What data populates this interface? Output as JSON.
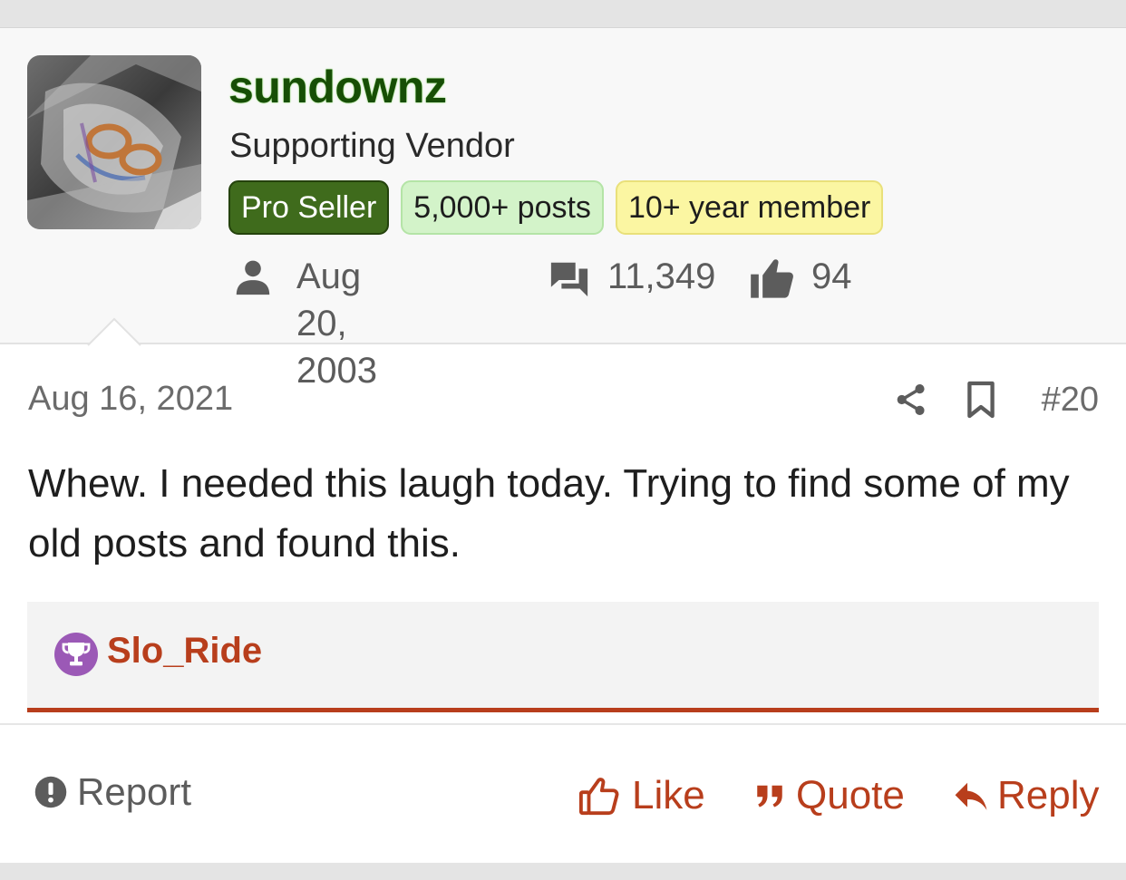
{
  "user": {
    "username": "sundownz",
    "user_title": "Supporting Vendor",
    "banners": [
      "Pro Seller",
      "5,000+ posts",
      "10+ year member"
    ],
    "joined": "Aug 20, 2003",
    "messages": "11,349",
    "reactions": "94"
  },
  "post": {
    "date": "Aug 16, 2021",
    "number": "#20",
    "message": "Whew. I needed this laugh today. Trying to find some of my old posts and found this."
  },
  "likes": {
    "liker": "Slo_Ride"
  },
  "footer": {
    "report_label": "Report",
    "like_label": "Like",
    "quote_label": "Quote",
    "reply_label": "Reply"
  },
  "colors": {
    "accent": "#b83e1c",
    "username": "#174e06",
    "pro_seller_banner": "#3f6b1c",
    "posts_banner": "#d3f3c9",
    "member_banner": "#fbf6a2",
    "trophy": "#9b59b6"
  },
  "icons": {
    "joined": "person-icon",
    "messages": "comments-icon",
    "reactions": "thumbs-up-icon",
    "share": "share-icon",
    "bookmark": "bookmark-icon",
    "trophy": "trophy-icon",
    "report": "exclamation-circle-icon",
    "like": "thumbs-up-outline-icon",
    "quote": "quote-icon",
    "reply": "reply-icon"
  }
}
